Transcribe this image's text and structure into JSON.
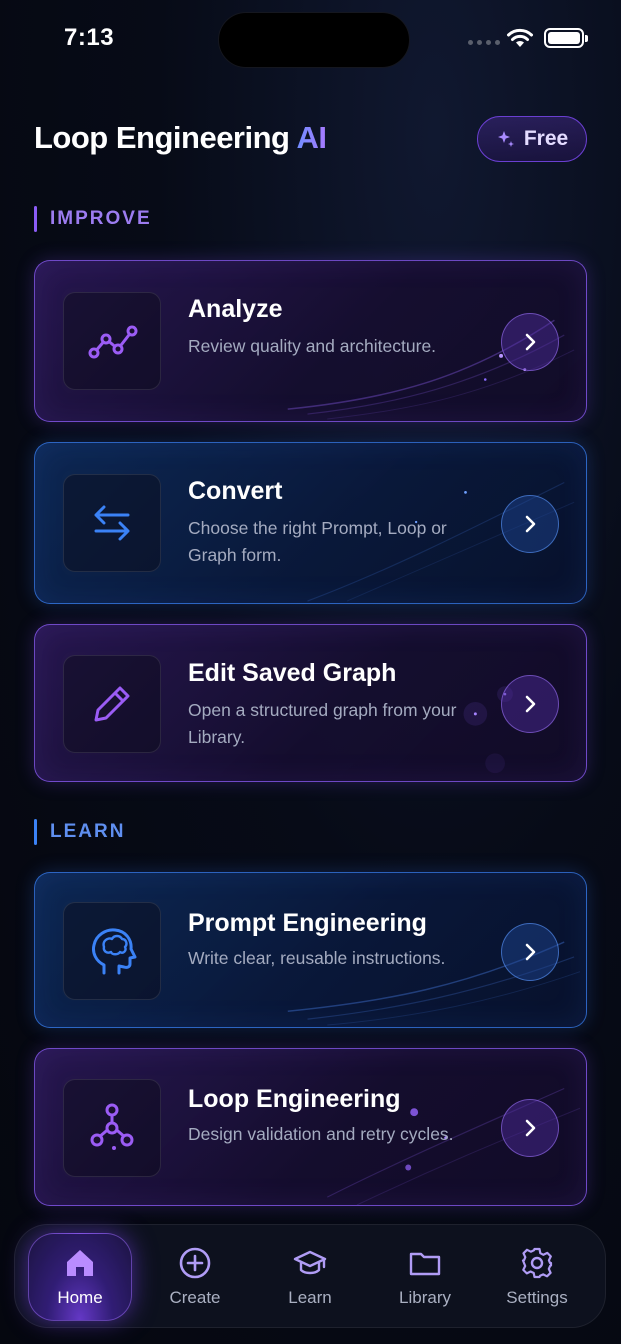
{
  "status_bar": {
    "time": "7:13"
  },
  "header": {
    "title_main": "Loop Engineering",
    "title_accent": "AI",
    "badge_label": "Free"
  },
  "sections": {
    "improve_label": "IMPROVE",
    "learn_label": "LEARN"
  },
  "cards": [
    {
      "title": "Analyze",
      "description": "Review quality and architecture.",
      "icon": "analytics-line-icon",
      "theme": "purple"
    },
    {
      "title": "Convert",
      "description": "Choose the right Prompt, Loop or Graph form.",
      "icon": "swap-arrows-icon",
      "theme": "blue"
    },
    {
      "title": "Edit Saved Graph",
      "description": "Open a structured graph from your Library.",
      "icon": "pencil-icon",
      "theme": "purple"
    },
    {
      "title": "Prompt Engineering",
      "description": "Write clear, reusable instructions.",
      "icon": "brain-head-icon",
      "theme": "blue"
    },
    {
      "title": "Loop Engineering",
      "description": "Design validation and retry cycles.",
      "icon": "node-graph-icon",
      "theme": "purple"
    }
  ],
  "tab_bar": [
    {
      "label": "Home",
      "icon": "home-icon",
      "active": true
    },
    {
      "label": "Create",
      "icon": "plus-circle-icon",
      "active": false
    },
    {
      "label": "Learn",
      "icon": "graduation-cap-icon",
      "active": false
    },
    {
      "label": "Library",
      "icon": "folder-icon",
      "active": false
    },
    {
      "label": "Settings",
      "icon": "gear-icon",
      "active": false
    }
  ],
  "colors": {
    "background": "#05070f",
    "purple_accent": "#8b5cf6",
    "blue_accent": "#3b82f6",
    "text_secondary": "#a4abc0"
  }
}
